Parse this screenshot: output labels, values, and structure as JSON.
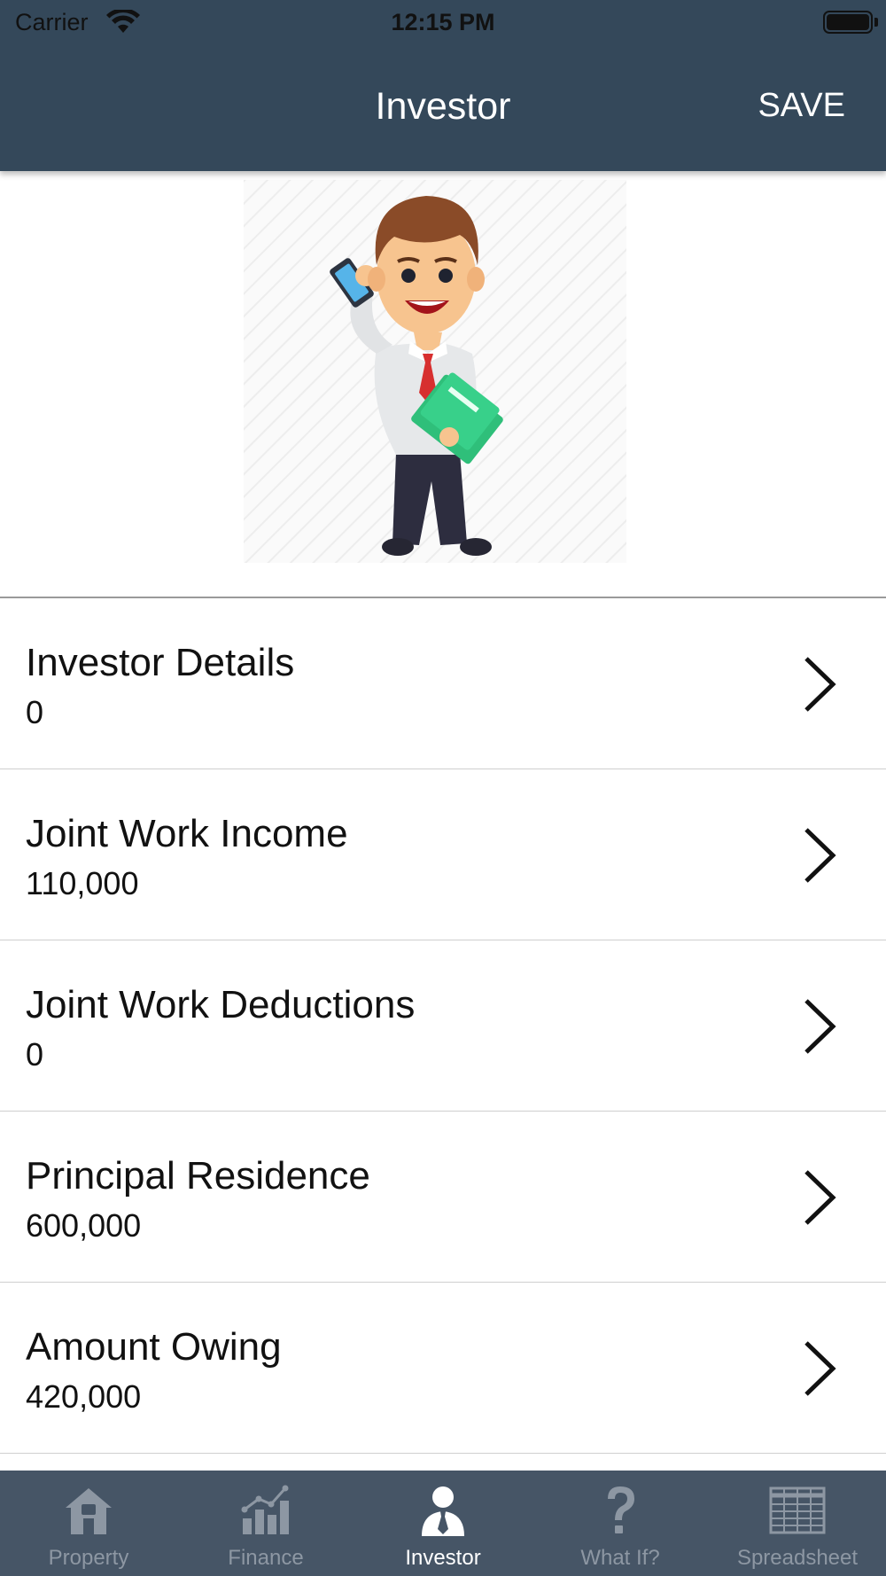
{
  "status_bar": {
    "carrier": "Carrier",
    "time": "12:15 PM"
  },
  "header": {
    "title": "Investor",
    "save_label": "SAVE",
    "background": "#34485a"
  },
  "avatar": {
    "icon": "businessman-illustration"
  },
  "list": {
    "items": [
      {
        "title": "Investor Details",
        "value": "0"
      },
      {
        "title": "Joint Work Income",
        "value": "110,000"
      },
      {
        "title": "Joint Work Deductions",
        "value": "0"
      },
      {
        "title": "Principal Residence",
        "value": "600,000"
      },
      {
        "title": "Amount Owing",
        "value": "420,000"
      }
    ]
  },
  "tab_bar": {
    "background": "#465566",
    "active_color": "#ffffff",
    "inactive_color": "#8d97a3",
    "tabs": [
      {
        "label": "Property",
        "icon": "house-icon",
        "active": false
      },
      {
        "label": "Finance",
        "icon": "bar-chart-icon",
        "active": false
      },
      {
        "label": "Investor",
        "icon": "person-tie-icon",
        "active": true
      },
      {
        "label": "What If?",
        "icon": "question-mark-icon",
        "active": false
      },
      {
        "label": "Spreadsheet",
        "icon": "spreadsheet-grid-icon",
        "active": false
      }
    ]
  }
}
